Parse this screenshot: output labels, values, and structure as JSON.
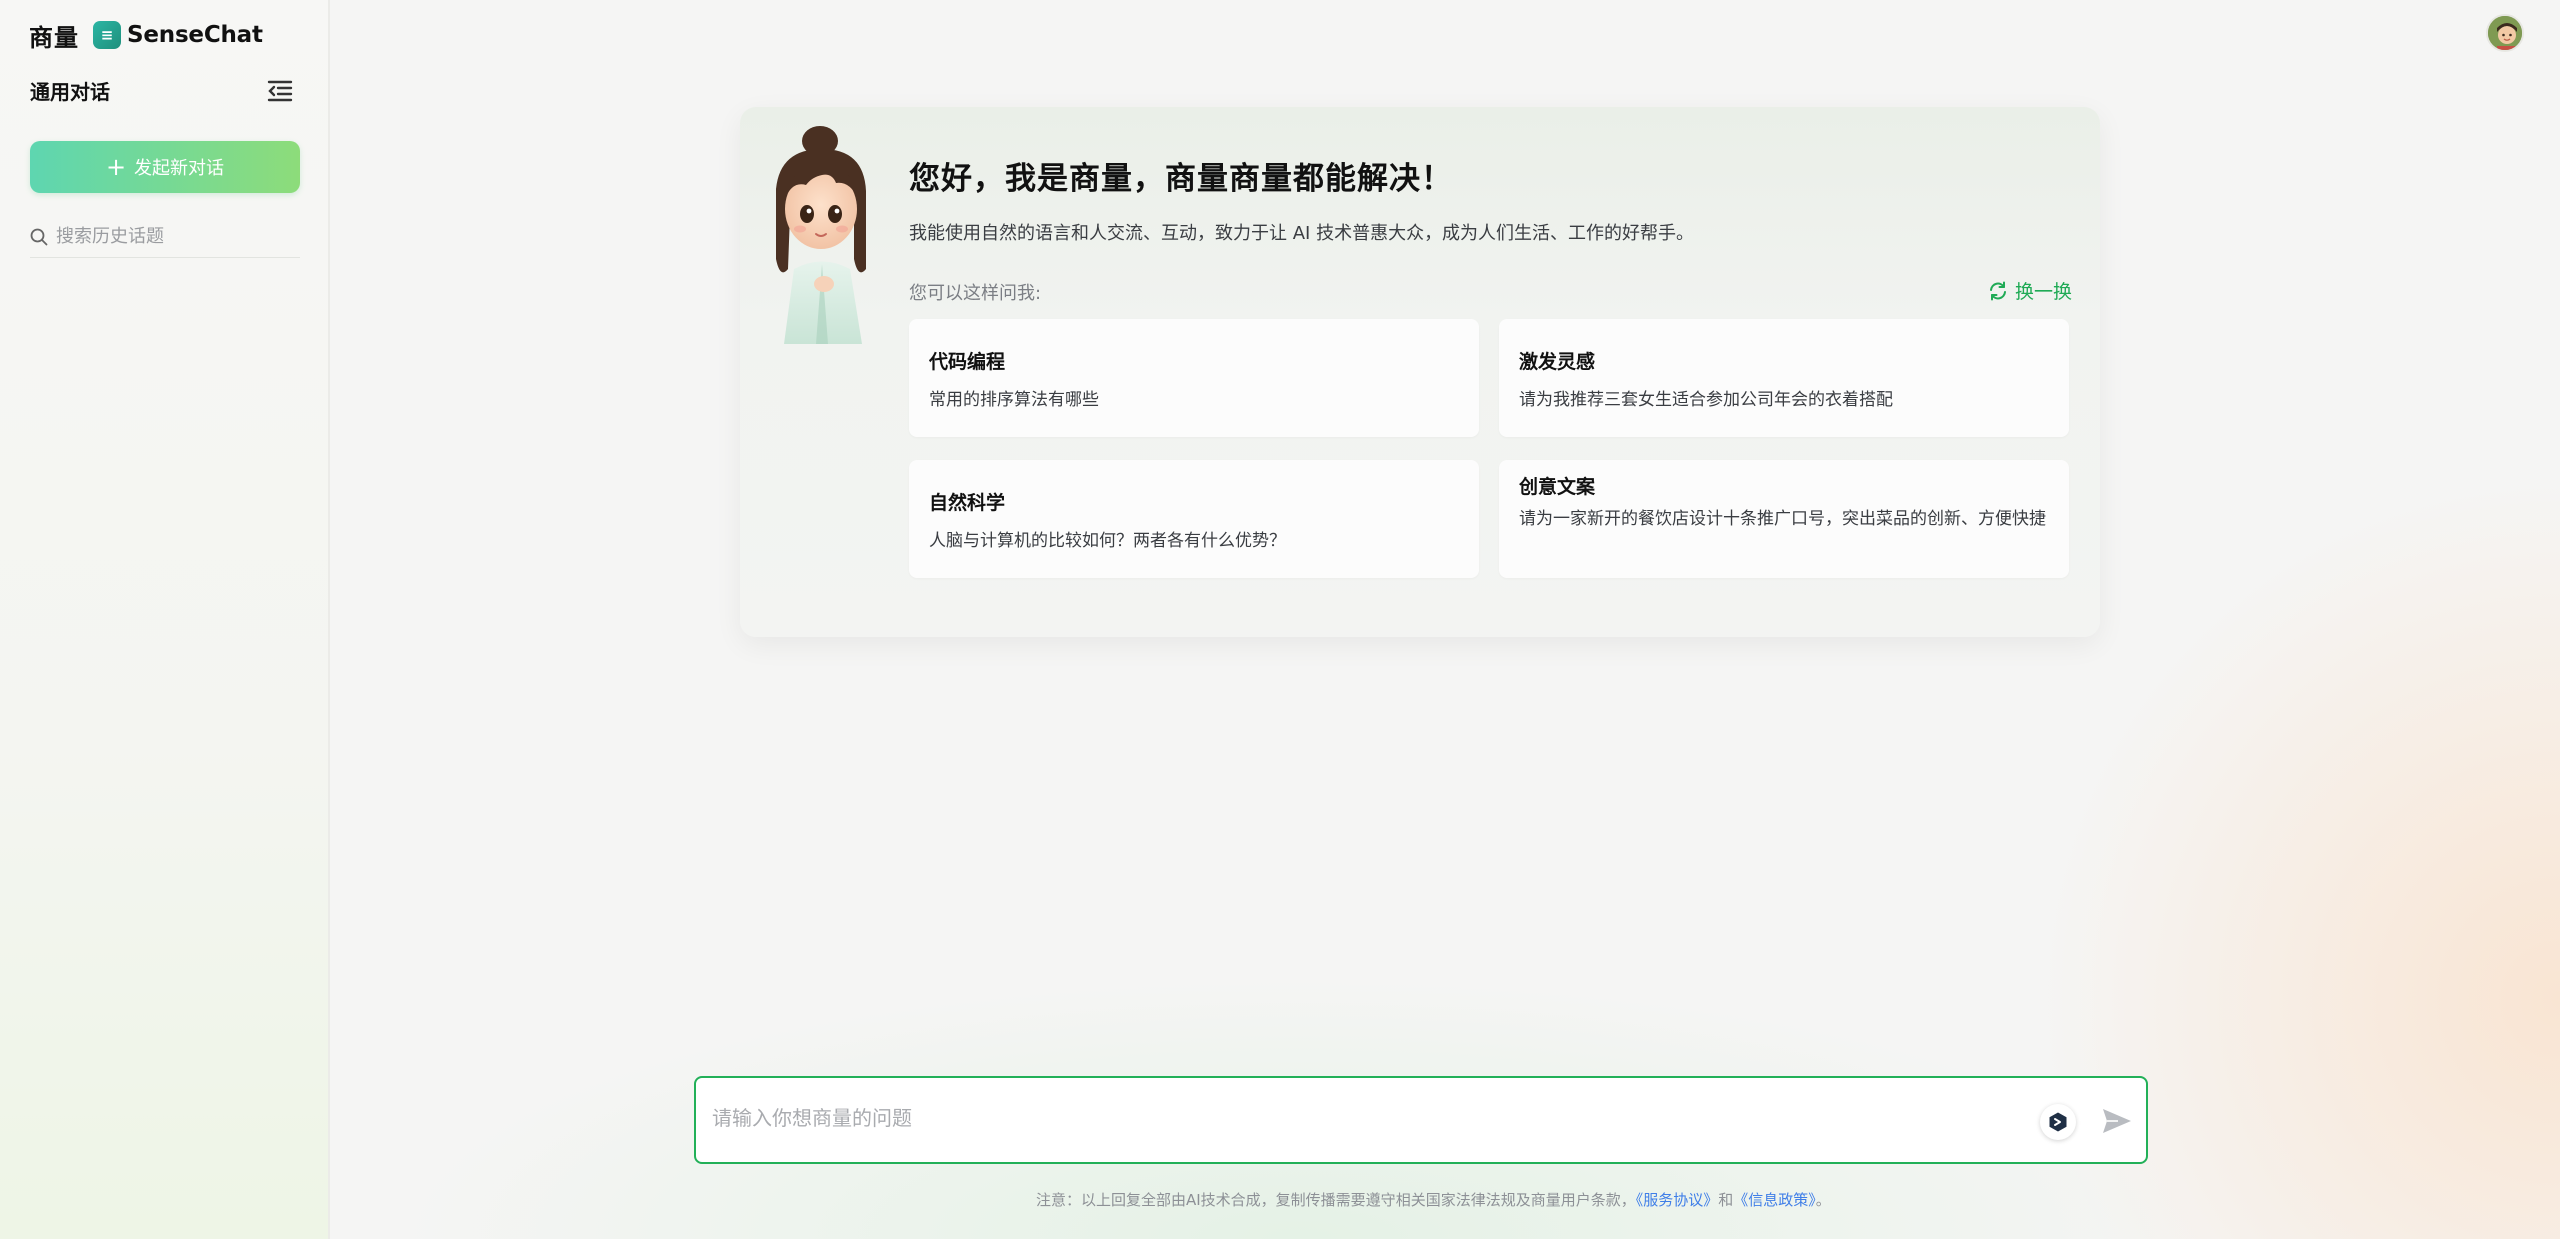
{
  "brand": {
    "cn_name": "商量",
    "logo_glyph": "≡",
    "en_name": "SenseChat"
  },
  "sidebar": {
    "section_title": "通用对话",
    "collapse_icon": "menu-collapse-icon",
    "new_chat_label": "发起新对话",
    "search_placeholder": "搜索历史话题"
  },
  "welcome": {
    "headline": "您好，我是商量，商量商量都能解决！",
    "intro": "我能使用自然的语言和人交流、互动，致力于让 AI 技术普惠大众，成为人们生活、工作的好帮手。",
    "ask_label": "您可以这样问我:",
    "refresh_label": "换一换",
    "suggestions": [
      {
        "title": "代码编程",
        "desc": "常用的排序算法有哪些"
      },
      {
        "title": "激发灵感",
        "desc": "请为我推荐三套女生适合参加公司年会的衣着搭配"
      },
      {
        "title": "自然科学",
        "desc": "人脑与计算机的比较如何？两者各有什么优势？"
      },
      {
        "title": "创意文案",
        "desc": "请为一家新开的餐饮店设计十条推广口号，突出菜品的创新、方便快捷"
      }
    ]
  },
  "composer": {
    "placeholder": "请输入你想商量的问题"
  },
  "footer": {
    "notice": "注意：以上回复全部由AI技术合成，复制传播需要遵守相关国家法律法规及商量用户条款，",
    "link_service": "《服务协议》",
    "conjunction": "和",
    "link_privacy": "《信息政策》",
    "end": "。"
  },
  "colors": {
    "accent_green": "#22b058",
    "new_chat_gradient_start": "#5ed6b0",
    "new_chat_gradient_end": "#8ddc7a",
    "link_blue": "#3f7ee8"
  }
}
